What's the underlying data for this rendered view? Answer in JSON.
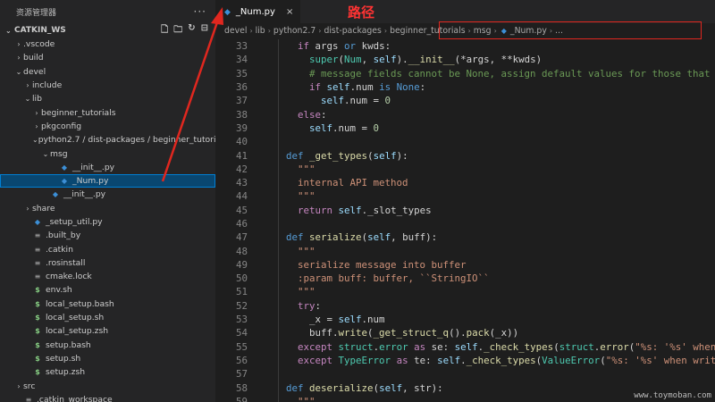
{
  "sidebar": {
    "title": "资源管理器",
    "more_glyph": "···",
    "workspace": "CATKIN_WS",
    "tree": [
      {
        "label": ".vscode",
        "indent": 1,
        "chev": "›",
        "icon": ""
      },
      {
        "label": "build",
        "indent": 1,
        "chev": "›",
        "icon": ""
      },
      {
        "label": "devel",
        "indent": 1,
        "chev": "⌄",
        "icon": ""
      },
      {
        "label": "include",
        "indent": 2,
        "chev": "›",
        "icon": ""
      },
      {
        "label": "lib",
        "indent": 2,
        "chev": "⌄",
        "icon": ""
      },
      {
        "label": "beginner_tutorials",
        "indent": 3,
        "chev": "›",
        "icon": ""
      },
      {
        "label": "pkgconfig",
        "indent": 3,
        "chev": "›",
        "icon": ""
      },
      {
        "label": "python2.7 / dist-packages / beginner_tutorials",
        "indent": 3,
        "chev": "⌄",
        "icon": ""
      },
      {
        "label": "msg",
        "indent": 4,
        "chev": "⌄",
        "icon": ""
      },
      {
        "label": "__init__.py",
        "indent": 5,
        "chev": "",
        "icon": "python"
      },
      {
        "label": "_Num.py",
        "indent": 5,
        "chev": "",
        "icon": "python",
        "selected": true
      },
      {
        "label": "__init__.py",
        "indent": 4,
        "chev": "",
        "icon": "python"
      },
      {
        "label": "share",
        "indent": 2,
        "chev": "›",
        "icon": ""
      },
      {
        "label": "_setup_util.py",
        "indent": 2,
        "chev": "",
        "icon": "python"
      },
      {
        "label": ".built_by",
        "indent": 2,
        "chev": "",
        "icon": "lines"
      },
      {
        "label": ".catkin",
        "indent": 2,
        "chev": "",
        "icon": "lines"
      },
      {
        "label": ".rosinstall",
        "indent": 2,
        "chev": "",
        "icon": "lines"
      },
      {
        "label": "cmake.lock",
        "indent": 2,
        "chev": "",
        "icon": "lines"
      },
      {
        "label": "env.sh",
        "indent": 2,
        "chev": "",
        "icon": "dollar"
      },
      {
        "label": "local_setup.bash",
        "indent": 2,
        "chev": "",
        "icon": "dollar"
      },
      {
        "label": "local_setup.sh",
        "indent": 2,
        "chev": "",
        "icon": "dollar"
      },
      {
        "label": "local_setup.zsh",
        "indent": 2,
        "chev": "",
        "icon": "dollar"
      },
      {
        "label": "setup.bash",
        "indent": 2,
        "chev": "",
        "icon": "dollar"
      },
      {
        "label": "setup.sh",
        "indent": 2,
        "chev": "",
        "icon": "dollar"
      },
      {
        "label": "setup.zsh",
        "indent": 2,
        "chev": "",
        "icon": "dollar"
      },
      {
        "label": "src",
        "indent": 1,
        "chev": "›",
        "icon": ""
      },
      {
        "label": ".catkin_workspace",
        "indent": 1,
        "chev": "",
        "icon": "lines"
      }
    ]
  },
  "editor": {
    "tab_label": "_Num.py",
    "tab_close": "×",
    "annotation": "路径",
    "breadcrumb": [
      "devel",
      "lib",
      "python2.7",
      "dist-packages",
      "beginner_tutorials",
      "msg"
    ],
    "breadcrumb_file": "_Num.py",
    "breadcrumb_tail": "...",
    "code": [
      {
        "n": "33",
        "t": "    <span class='kc'>if</span> args <span class='k'>or</span> kwds:"
      },
      {
        "n": "34",
        "t": "      <span class='t'>super</span>(<span class='t'>Num</span>, <span class='v'>self</span>).<span class='f'>__init__</span>(*args, **kwds)"
      },
      {
        "n": "35",
        "t": "      <span class='c'># message fields cannot be None, assign default values for those that</span>"
      },
      {
        "n": "36",
        "t": "      <span class='kc'>if</span> <span class='v'>self</span>.num <span class='k'>is</span> <span class='k'>None</span>:"
      },
      {
        "n": "37",
        "t": "        <span class='v'>self</span>.num = <span class='n'>0</span>"
      },
      {
        "n": "38",
        "t": "    <span class='kc'>else</span>:"
      },
      {
        "n": "39",
        "t": "      <span class='v'>self</span>.num = <span class='n'>0</span>"
      },
      {
        "n": "40",
        "t": ""
      },
      {
        "n": "41",
        "t": "  <span class='k'>def</span> <span class='f'>_get_types</span>(<span class='v'>self</span>):"
      },
      {
        "n": "42",
        "t": "    <span class='s'>\"\"\"</span>"
      },
      {
        "n": "43",
        "t": "    <span class='s'>internal API method</span>"
      },
      {
        "n": "44",
        "t": "    <span class='s'>\"\"\"</span>"
      },
      {
        "n": "45",
        "t": "    <span class='kc'>return</span> <span class='v'>self</span>._slot_types"
      },
      {
        "n": "46",
        "t": ""
      },
      {
        "n": "47",
        "t": "  <span class='k'>def</span> <span class='f'>serialize</span>(<span class='v'>self</span>, buff):"
      },
      {
        "n": "48",
        "t": "    <span class='s'>\"\"\"</span>"
      },
      {
        "n": "49",
        "t": "    <span class='s'>serialize message into buffer</span>"
      },
      {
        "n": "50",
        "t": "    <span class='s'>:param buff: buffer, ``StringIO``</span>"
      },
      {
        "n": "51",
        "t": "    <span class='s'>\"\"\"</span>"
      },
      {
        "n": "52",
        "t": "    <span class='kc'>try</span>:"
      },
      {
        "n": "53",
        "t": "      _x = <span class='v'>self</span>.num"
      },
      {
        "n": "54",
        "t": "      buff.<span class='f'>write</span>(<span class='f'>_get_struct_q</span>().<span class='f'>pack</span>(_x))"
      },
      {
        "n": "55",
        "t": "    <span class='kc'>except</span> <span class='t'>struct</span>.<span class='t'>error</span> <span class='kc'>as</span> se: <span class='v'>self</span>.<span class='f'>_check_types</span>(<span class='t'>struct</span>.<span class='f'>error</span>(<span class='s'>\"%s: '%s' when</span>"
      },
      {
        "n": "56",
        "t": "    <span class='kc'>except</span> <span class='t'>TypeError</span> <span class='kc'>as</span> te: <span class='v'>self</span>.<span class='f'>_check_types</span>(<span class='t'>ValueError</span>(<span class='s'>\"%s: '%s' when writ</span>"
      },
      {
        "n": "57",
        "t": ""
      },
      {
        "n": "58",
        "t": "  <span class='k'>def</span> <span class='f'>deserialize</span>(<span class='v'>self</span>, str):"
      },
      {
        "n": "59",
        "t": "    <span class='s'>\"\"\"</span>"
      }
    ]
  },
  "watermark": "www.toymoban.com",
  "colors": {
    "accent": "#007fd4",
    "annotation_red": "#e0271f",
    "selected_bg": "#094771"
  }
}
